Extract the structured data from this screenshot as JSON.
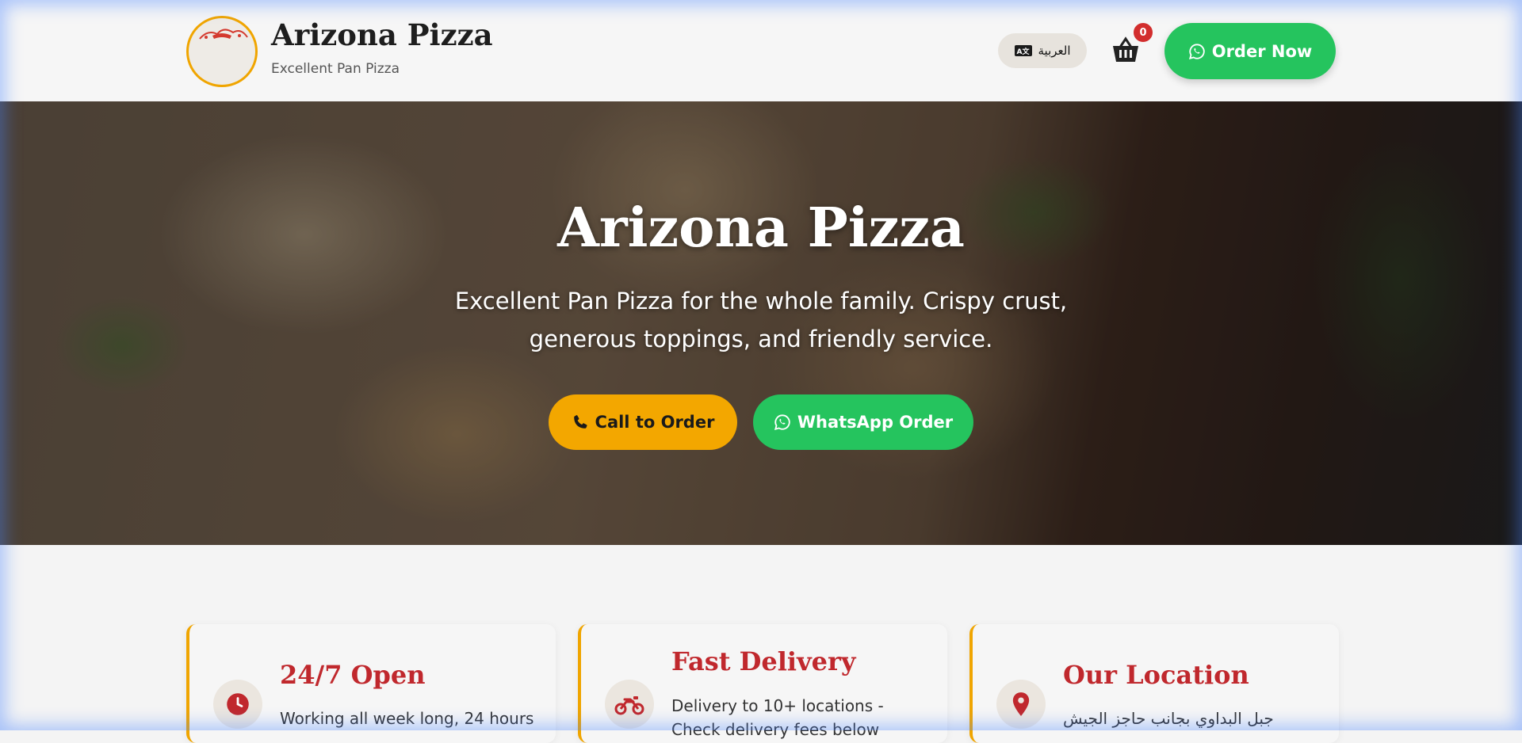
{
  "header": {
    "brand_title": "Arizona Pizza",
    "brand_subtitle": "Excellent Pan Pizza",
    "language_label": "العربية",
    "language_icon": "translate-icon",
    "cart_count": "0",
    "cart_icon": "basket-icon",
    "order_label": "Order Now",
    "order_icon": "whatsapp-icon"
  },
  "hero": {
    "title": "Arizona Pizza",
    "subtitle_line1": "Excellent Pan Pizza for the whole family. Crispy crust,",
    "subtitle_line2": "generous toppings, and friendly service.",
    "call_label": "Call to Order",
    "call_icon": "phone-icon",
    "whatsapp_label": "WhatsApp Order",
    "whatsapp_icon": "whatsapp-icon"
  },
  "features": [
    {
      "title": "24/7 Open",
      "text": "Working all week long, 24 hours",
      "icon": "clock-icon"
    },
    {
      "title": "Fast Delivery",
      "text": "Delivery to 10+ locations - Check delivery fees below",
      "icon": "motorcycle-icon"
    },
    {
      "title": "Our Location",
      "text": "جبل البداوي بجانب حاجز الجيش",
      "icon": "map-pin-icon"
    }
  ],
  "colors": {
    "accent": "#f0a500",
    "whatsapp_green": "#25c45e",
    "brand_red": "#c0282d",
    "badge_red": "#d22d2d"
  }
}
